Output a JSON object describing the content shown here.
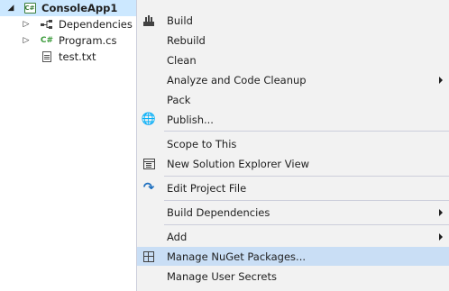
{
  "tree": {
    "project": {
      "label": "ConsoleApp1",
      "icon": "csharp-project-icon"
    },
    "items": [
      {
        "label": "Dependencies",
        "icon": "dependencies-icon"
      },
      {
        "label": "Program.cs",
        "icon": "csharp-file-icon"
      },
      {
        "label": "test.txt",
        "icon": "text-file-icon"
      }
    ]
  },
  "menu": {
    "items": [
      {
        "label": "Build",
        "icon": "build-icon"
      },
      {
        "label": "Rebuild"
      },
      {
        "label": "Clean"
      },
      {
        "label": "Analyze and Code Cleanup",
        "submenu": true
      },
      {
        "label": "Pack"
      },
      {
        "label": "Publish...",
        "icon": "publish-globe-icon"
      },
      {
        "label": "Scope to This"
      },
      {
        "label": "New Solution Explorer View",
        "icon": "new-view-icon"
      },
      {
        "label": "Edit Project File",
        "icon": "edit-project-icon"
      },
      {
        "label": "Build Dependencies",
        "submenu": true
      },
      {
        "label": "Add",
        "submenu": true
      },
      {
        "label": "Manage NuGet Packages...",
        "icon": "nuget-icon",
        "highlighted": true
      },
      {
        "label": "Manage User Secrets"
      }
    ]
  },
  "colors": {
    "selection": "#cce8ff",
    "menu_background": "#f2f2f2",
    "menu_highlight": "#c9def5",
    "separator": "#cccedb"
  }
}
